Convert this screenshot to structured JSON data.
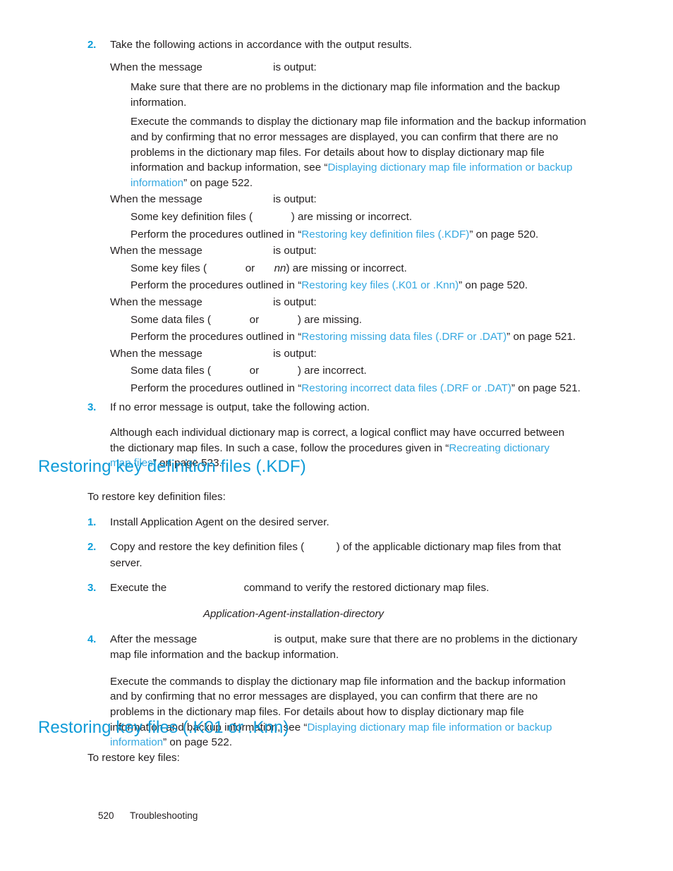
{
  "document": {
    "footer": {
      "page_number": "520",
      "chapter": "Troubleshooting"
    }
  },
  "steps": {
    "step2": {
      "marker": "2.",
      "text": "Take the following actions in accordance with the output results."
    },
    "step3": {
      "marker": "3.",
      "text": "If no error message is output, take the following action.",
      "body_1": "Although each individual dictionary map is correct, a logical conflict may have occurred between the dictionary map files. In such a case, follow the procedures given in “",
      "body_link": "Recreating dictionary map files",
      "body_2": "” on page 523."
    }
  },
  "cases": [
    {
      "intro_pre": "When the message",
      "intro_gap": "           ",
      "intro_post": "is output:",
      "lines": [
        "Make sure that there are no problems in the dictionary map file information and the backup information.",
        "Execute the commands to display the dictionary map file information and the backup information and by confirming that no error messages are displayed, you can confirm that there are no problems in the dictionary map files. For details about how to display dictionary map file information and backup information, see “"
      ],
      "link": "Displaying dictionary map file information or backup information",
      "link_tail": "” on page 522."
    },
    {
      "intro_pre": "When the message",
      "intro_gap": "           ",
      "intro_post": "is output:",
      "desc_pre": "Some key definition files (",
      "desc_gap": "      ",
      "desc_post": ") are missing or incorrect.",
      "action_pre": "Perform the procedures outlined in “",
      "link": "Restoring key definition files (.KDF)",
      "action_post": "” on page 520."
    },
    {
      "intro_pre": "When the message",
      "intro_gap": "           ",
      "intro_post": "is output:",
      "desc_pre": "Some key files (",
      "desc_gap1": "      ",
      "desc_mid": "or",
      "desc_gap2": "   ",
      "desc_ital": "nn",
      "desc_post": ") are missing or incorrect.",
      "action_pre": "Perform the procedures outlined in “",
      "link": "Restoring key files (.K01 or .Knn)",
      "action_post": "” on page 520."
    },
    {
      "intro_pre": "When the message",
      "intro_gap": "           ",
      "intro_post": "is output:",
      "desc_pre": "Some data files (",
      "desc_gap1": "      ",
      "desc_mid": "or",
      "desc_gap2": "      ",
      "desc_post": ") are missing.",
      "action_pre": "Perform the procedures outlined in “",
      "link": "Restoring missing data files (.DRF or .DAT)",
      "action_post": "” on page 521."
    },
    {
      "intro_pre": "When the message",
      "intro_gap": "           ",
      "intro_post": "is output:",
      "desc_pre": "Some data files (",
      "desc_gap1": "      ",
      "desc_mid": "or",
      "desc_gap2": "      ",
      "desc_post": ") are incorrect.",
      "action_pre": "Perform the procedures outlined in “",
      "link": "Restoring incorrect data files (.DRF or .DAT)",
      "action_post": "” on page 521."
    }
  ],
  "section_kdf": {
    "heading": "Restoring key definition files (.KDF)",
    "lead": "To restore key definition files:",
    "items": [
      {
        "marker": "1.",
        "text": "Install Application Agent on the desired server."
      },
      {
        "marker": "2.",
        "pre": "Copy and restore the key definition files (",
        "gap": "     ",
        "post": ") of the applicable dictionary map files from that server."
      },
      {
        "marker": "3.",
        "pre": "Execute the",
        "gap": "            ",
        "post": "command to verify the restored dictionary map files.",
        "code_italic": "Application-Agent-installation-directory"
      },
      {
        "marker": "4.",
        "pre": "After the message",
        "gap": "            ",
        "post": "is output, make sure that there are no problems in the dictionary map file information and the backup information.",
        "body_pre": "Execute the commands to display the dictionary map file information and the backup information and by confirming that no error messages are displayed, you can confirm that there are no problems in the dictionary map files. For details about how to display dictionary map file information and backup information, see “",
        "body_link": "Displaying dictionary map file information or backup information",
        "body_post": "” on page 522."
      }
    ]
  },
  "section_knn": {
    "heading": "Restoring key files (.K01 or .Knn)",
    "lead": "To restore key files:"
  },
  "colors": {
    "heading_blue": "#0f9bd7",
    "link_blue": "#35a8e0",
    "marker_blue": "#0b9dd9",
    "body_text": "#231f20"
  }
}
